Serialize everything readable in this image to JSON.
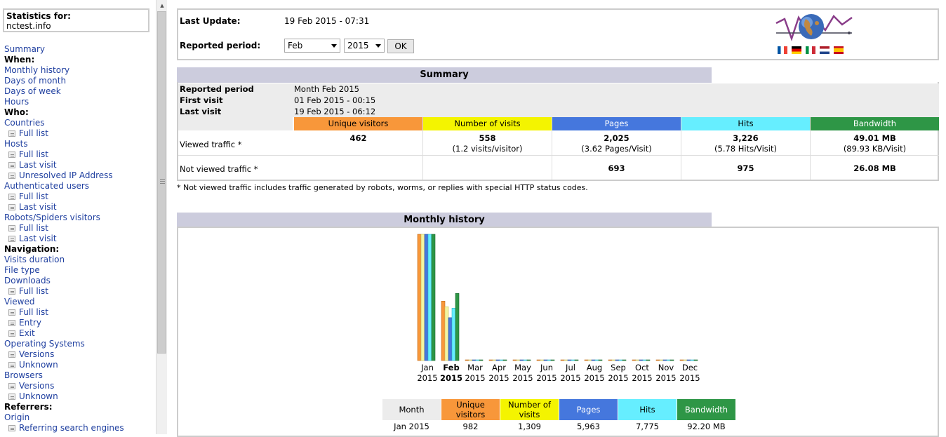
{
  "sidebar": {
    "stats_label": "Statistics for:",
    "site": "nctest.info",
    "nav": [
      {
        "type": "link",
        "label": "Summary"
      },
      {
        "type": "header",
        "label": "When:"
      },
      {
        "type": "link",
        "label": "Monthly history"
      },
      {
        "type": "link",
        "label": "Days of month"
      },
      {
        "type": "link",
        "label": "Days of week"
      },
      {
        "type": "link",
        "label": "Hours"
      },
      {
        "type": "header",
        "label": "Who:"
      },
      {
        "type": "link",
        "label": "Countries"
      },
      {
        "type": "sub",
        "label": "Full list"
      },
      {
        "type": "link",
        "label": "Hosts"
      },
      {
        "type": "sub",
        "label": "Full list"
      },
      {
        "type": "sub",
        "label": "Last visit"
      },
      {
        "type": "sub",
        "label": "Unresolved IP Address"
      },
      {
        "type": "link",
        "label": "Authenticated users"
      },
      {
        "type": "sub",
        "label": "Full list"
      },
      {
        "type": "sub",
        "label": "Last visit"
      },
      {
        "type": "link",
        "label": "Robots/Spiders visitors"
      },
      {
        "type": "sub",
        "label": "Full list"
      },
      {
        "type": "sub",
        "label": "Last visit"
      },
      {
        "type": "header",
        "label": "Navigation:"
      },
      {
        "type": "link",
        "label": "Visits duration"
      },
      {
        "type": "link",
        "label": "File type"
      },
      {
        "type": "link",
        "label": "Downloads"
      },
      {
        "type": "sub",
        "label": "Full list"
      },
      {
        "type": "link",
        "label": "Viewed"
      },
      {
        "type": "sub",
        "label": "Full list"
      },
      {
        "type": "sub",
        "label": "Entry"
      },
      {
        "type": "sub",
        "label": "Exit"
      },
      {
        "type": "link",
        "label": "Operating Systems"
      },
      {
        "type": "sub",
        "label": "Versions"
      },
      {
        "type": "sub",
        "label": "Unknown"
      },
      {
        "type": "link",
        "label": "Browsers"
      },
      {
        "type": "sub",
        "label": "Versions"
      },
      {
        "type": "sub",
        "label": "Unknown"
      },
      {
        "type": "header",
        "label": "Referrers:"
      },
      {
        "type": "link",
        "label": "Origin"
      },
      {
        "type": "sub",
        "label": "Referring search engines"
      }
    ]
  },
  "top": {
    "last_update_label": "Last Update:",
    "last_update_value": "19 Feb 2015 - 07:31",
    "period_label": "Reported period:",
    "month_value": "Feb",
    "year_value": "2015",
    "ok_label": "OK",
    "flags": [
      {
        "name": "french-flag-icon",
        "colors": [
          "#0055a4",
          "#ffffff",
          "#ef4135"
        ]
      },
      {
        "name": "german-flag-icon",
        "colors": [
          "#000000",
          "#dd0000",
          "#ffce00"
        ]
      },
      {
        "name": "italian-flag-icon",
        "colors": [
          "#009246",
          "#ffffff",
          "#ce2b37"
        ]
      },
      {
        "name": "dutch-flag-icon",
        "colors": [
          "#ae1c28",
          "#ffffff",
          "#21468b"
        ]
      },
      {
        "name": "spanish-flag-icon",
        "colors": [
          "#c60b1e",
          "#ffc400",
          "#c60b1e"
        ]
      }
    ]
  },
  "summary": {
    "title": "Summary",
    "reported_period_label": "Reported period",
    "reported_period_value": "Month Feb 2015",
    "first_visit_label": "First visit",
    "first_visit_value": "01 Feb 2015 - 00:15",
    "last_visit_label": "Last visit",
    "last_visit_value": "19 Feb 2015 - 06:12",
    "columns": [
      "Unique visitors",
      "Number of visits",
      "Pages",
      "Hits",
      "Bandwidth"
    ],
    "viewed_label": "Viewed traffic *",
    "viewed": [
      {
        "main": "462",
        "sub": ""
      },
      {
        "main": "558",
        "sub": "(1.2 visits/visitor)"
      },
      {
        "main": "2,025",
        "sub": "(3.62 Pages/Visit)"
      },
      {
        "main": "3,226",
        "sub": "(5.78 Hits/Visit)"
      },
      {
        "main": "49.01 MB",
        "sub": "(89.93 KB/Visit)"
      }
    ],
    "not_viewed_label": "Not viewed traffic *",
    "not_viewed": [
      "",
      "",
      "693",
      "975",
      "26.08 MB"
    ],
    "note": "* Not viewed traffic includes traffic generated by robots, worms, or replies with special HTTP status codes."
  },
  "colors": {
    "visitors": "#f8973a",
    "visits": "#f4f400",
    "pages": "#4577dd",
    "hits": "#66eeff",
    "bandwidth": "#2e9646",
    "section": "#ccccdd"
  },
  "monthly": {
    "title": "Monthly history",
    "table_month_header": "Month",
    "table_headers": [
      "Unique visitors",
      "Number of visits",
      "Pages",
      "Hits",
      "Bandwidth"
    ],
    "table_row": [
      "Jan 2015",
      "982",
      "1,309",
      "5,963",
      "7,775",
      "92.20 MB"
    ]
  },
  "chart_data": {
    "type": "bar",
    "categories": [
      "Jan",
      "Feb",
      "Mar",
      "Apr",
      "May",
      "Jun",
      "Jul",
      "Aug",
      "Sep",
      "Oct",
      "Nov",
      "Dec"
    ],
    "year_label": "2015",
    "current": "Feb",
    "series": [
      {
        "name": "Unique visitors",
        "values": [
          982,
          462,
          0,
          0,
          0,
          0,
          0,
          0,
          0,
          0,
          0,
          0
        ]
      },
      {
        "name": "Number of visits",
        "values": [
          1309,
          558,
          0,
          0,
          0,
          0,
          0,
          0,
          0,
          0,
          0,
          0
        ]
      },
      {
        "name": "Pages",
        "values": [
          5963,
          2025,
          0,
          0,
          0,
          0,
          0,
          0,
          0,
          0,
          0,
          0
        ]
      },
      {
        "name": "Hits",
        "values": [
          7775,
          3226,
          0,
          0,
          0,
          0,
          0,
          0,
          0,
          0,
          0,
          0
        ]
      },
      {
        "name": "Bandwidth",
        "values": [
          92.2,
          49.01,
          0,
          0,
          0,
          0,
          0,
          0,
          0,
          0,
          0,
          0
        ]
      }
    ]
  }
}
